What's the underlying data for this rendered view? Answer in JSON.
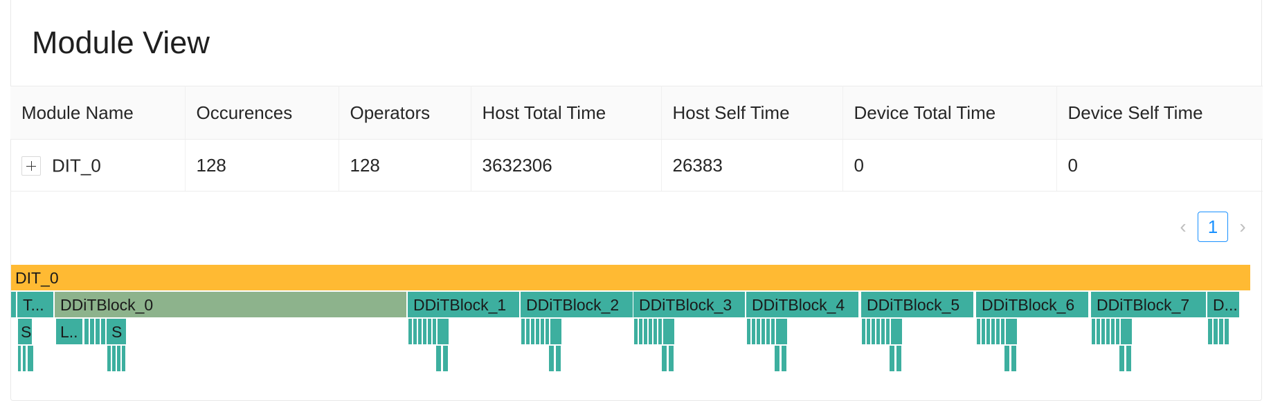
{
  "page": {
    "title": "Module View"
  },
  "table": {
    "columns": [
      "Module Name",
      "Occurences",
      "Operators",
      "Host Total Time",
      "Host Self Time",
      "Device Total Time",
      "Device Self Time"
    ],
    "rows": [
      {
        "module_name": "DIT_0",
        "occurences": "128",
        "operators": "128",
        "host_total_time": "3632306",
        "host_self_time": "26383",
        "device_total_time": "0",
        "device_self_time": "0"
      }
    ]
  },
  "pagination": {
    "current_page": "1",
    "prev_icon": "chevron-left-icon",
    "next_icon": "chevron-right-icon"
  },
  "flamegraph": {
    "colors": {
      "root": "#ffba33",
      "block_highlight": "#8db38c",
      "block": "#3daf9f"
    },
    "root_label": "DIT_0",
    "level1_labels": [
      "T...",
      "DDiTBlock_0",
      "DDiTBlock_1",
      "DDiTBlock_2",
      "DDiTBlock_3",
      "DDiTBlock_4",
      "DDiTBlock_5",
      "DDiTBlock_6",
      "DDiTBlock_7",
      "D..."
    ],
    "level2_labels": [
      "S",
      "L..",
      "S"
    ]
  }
}
